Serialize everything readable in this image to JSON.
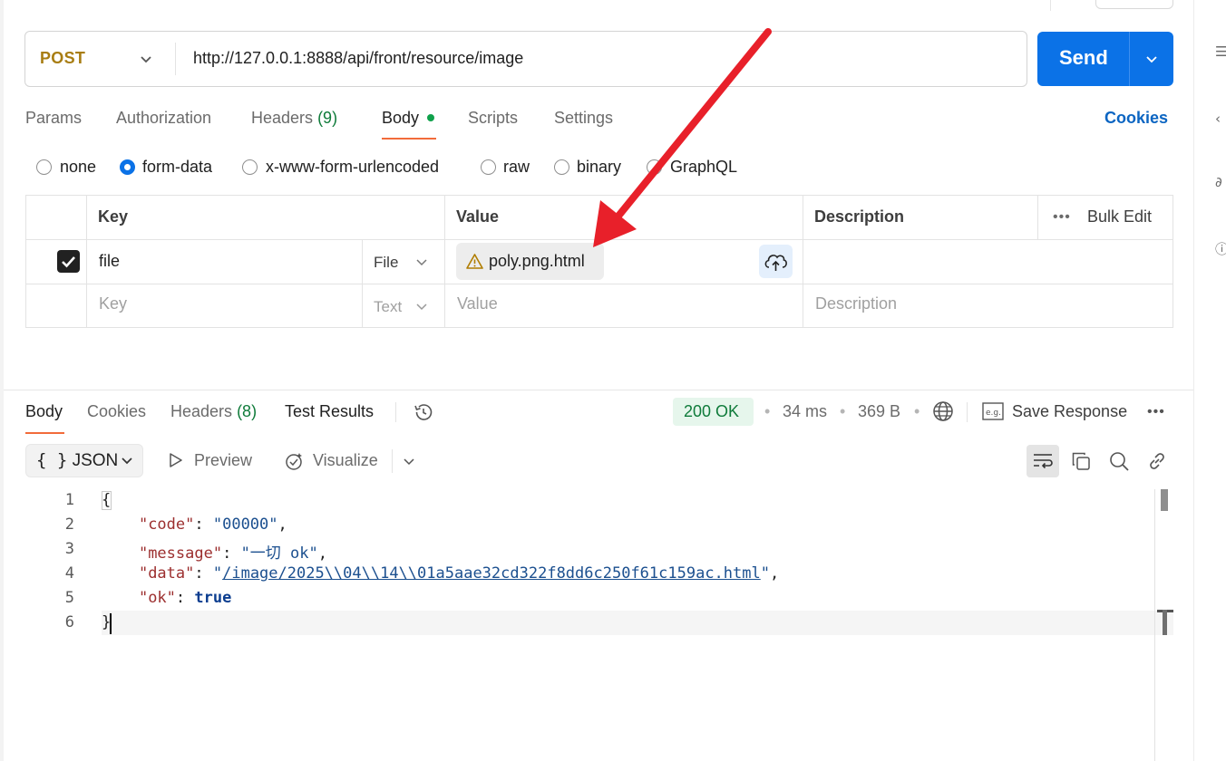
{
  "request": {
    "method": "POST",
    "url": "http://127.0.0.1:8888/api/front/resource/image",
    "send_label": "Send"
  },
  "request_tabs": {
    "params": "Params",
    "authorization": "Authorization",
    "headers": "Headers",
    "headers_count": "(9)",
    "body": "Body",
    "scripts": "Scripts",
    "settings": "Settings",
    "cookies": "Cookies"
  },
  "body_types": {
    "none": "none",
    "form_data": "form-data",
    "urlencoded": "x-www-form-urlencoded",
    "raw": "raw",
    "binary": "binary",
    "graphql": "GraphQL",
    "selected": "form-data"
  },
  "form_table": {
    "headers": {
      "key": "Key",
      "value": "Value",
      "description": "Description",
      "bulk_edit": "Bulk Edit"
    },
    "rows": [
      {
        "checked": true,
        "key": "file",
        "type": "File",
        "value": "poly.png.html",
        "description": ""
      }
    ],
    "placeholder_row": {
      "key": "Key",
      "type": "Text",
      "value": "Value",
      "description": "Description"
    }
  },
  "response": {
    "tabs": {
      "body": "Body",
      "cookies": "Cookies",
      "headers": "Headers",
      "headers_count": "(8)",
      "test_results": "Test Results"
    },
    "status": "200 OK",
    "time": "34 ms",
    "size": "369 B",
    "save_response": "Save Response",
    "format": "JSON",
    "preview": "Preview",
    "visualize": "Visualize",
    "code_lines": {
      "l1": "{",
      "code_key": "\"code\"",
      "code_val": "\"00000\"",
      "message_key": "\"message\"",
      "message_val": "\"一切 ok\"",
      "data_key": "\"data\"",
      "data_val": "/image/2025\\\\04\\\\14\\\\01a5aae32cd322f8dd6c250f61c159ac.html",
      "ok_key": "\"ok\"",
      "ok_val": "true",
      "l6": "}"
    },
    "line_numbers": [
      "1",
      "2",
      "3",
      "4",
      "5",
      "6"
    ]
  },
  "colors": {
    "send": "#0b72e7",
    "method": "#a87d12",
    "status_ok": "#0f7b3a",
    "tab_accent": "#f26b3a",
    "annotation_arrow": "#e8202a"
  }
}
